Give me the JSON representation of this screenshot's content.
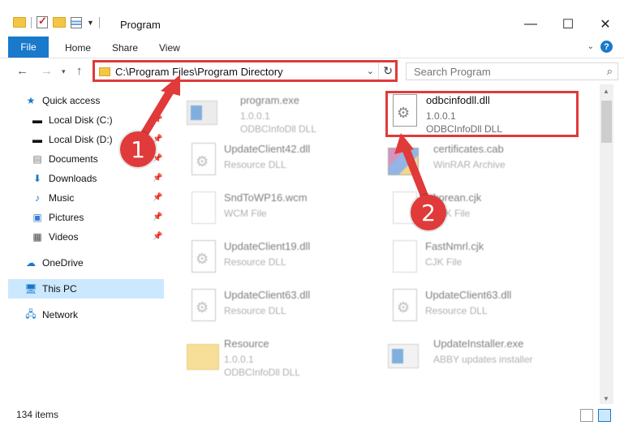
{
  "window": {
    "title": "Program",
    "minimize_icon": "minimize-icon",
    "maximize_icon": "maximize-icon",
    "close_icon": "close-icon"
  },
  "ribbon": {
    "tabs": [
      "File",
      "Home",
      "Share",
      "View"
    ]
  },
  "nav": {
    "address": "C:\\Program Files\\Program Directory",
    "search_placeholder": "Search Program"
  },
  "sidebar": {
    "items": [
      {
        "label": "Quick access",
        "icon": "star-icon"
      },
      {
        "label": "Local Disk (C:)",
        "icon": "drive-icon",
        "pinned": true
      },
      {
        "label": "Local Disk (D:)",
        "icon": "drive-icon",
        "pinned": true
      },
      {
        "label": "Documents",
        "icon": "documents-icon",
        "pinned": true
      },
      {
        "label": "Downloads",
        "icon": "downloads-icon",
        "pinned": true
      },
      {
        "label": "Music",
        "icon": "music-icon",
        "pinned": true
      },
      {
        "label": "Pictures",
        "icon": "pictures-icon",
        "pinned": true
      },
      {
        "label": "Videos",
        "icon": "videos-icon",
        "pinned": true
      },
      {
        "label": "OneDrive",
        "icon": "onedrive-icon"
      },
      {
        "label": "This PC",
        "icon": "pc-icon",
        "selected": true
      },
      {
        "label": "Network",
        "icon": "network-icon"
      }
    ]
  },
  "files": [
    {
      "name": "program.exe",
      "line2": "1.0.0.1",
      "line3": "ODBCInfoDll DLL",
      "icon": "program-icon"
    },
    {
      "name": "odbcinfodll.dll",
      "line2": "1.0.0.1",
      "line3": "ODBCInfoDll DLL",
      "icon": "dll-icon"
    },
    {
      "name": "UpdateClient42.dll",
      "line2": "Resource DLL",
      "line3": "",
      "icon": "dll-icon"
    },
    {
      "name": "certificates.cab",
      "line2": "WinRAR Archive",
      "line3": "",
      "icon": "archive-icon"
    },
    {
      "name": "SndToWP16.wcm",
      "line2": "WCM File",
      "line3": "",
      "icon": "file-icon"
    },
    {
      "name": "korean.cjk",
      "line2": "CJK File",
      "line3": "",
      "icon": "file-icon"
    },
    {
      "name": "UpdateClient19.dll",
      "line2": "Resource DLL",
      "line3": "",
      "icon": "dll-icon"
    },
    {
      "name": "FastNmrl.cjk",
      "line2": "CJK File",
      "line3": "",
      "icon": "file-icon"
    },
    {
      "name": "UpdateClient63.dll",
      "line2": "Resource DLL",
      "line3": "",
      "icon": "dll-icon"
    },
    {
      "name": "UpdateClient63.dll",
      "line2": "Resource DLL",
      "line3": "",
      "icon": "dll-icon"
    },
    {
      "name": "Resource",
      "line2": "1.0.0.1",
      "line3": "ODBCInfoDll DLL",
      "icon": "folder-icon"
    },
    {
      "name": "UpdateInstaller.exe",
      "line2": "ABBY updates installer",
      "line3": "",
      "icon": "exe-icon"
    }
  ],
  "status": {
    "count": "134 items"
  },
  "callouts": [
    "1",
    "2"
  ],
  "colors": {
    "accent": "#1979ca",
    "highlight": "#e03a3a",
    "selected": "#cce8ff"
  }
}
